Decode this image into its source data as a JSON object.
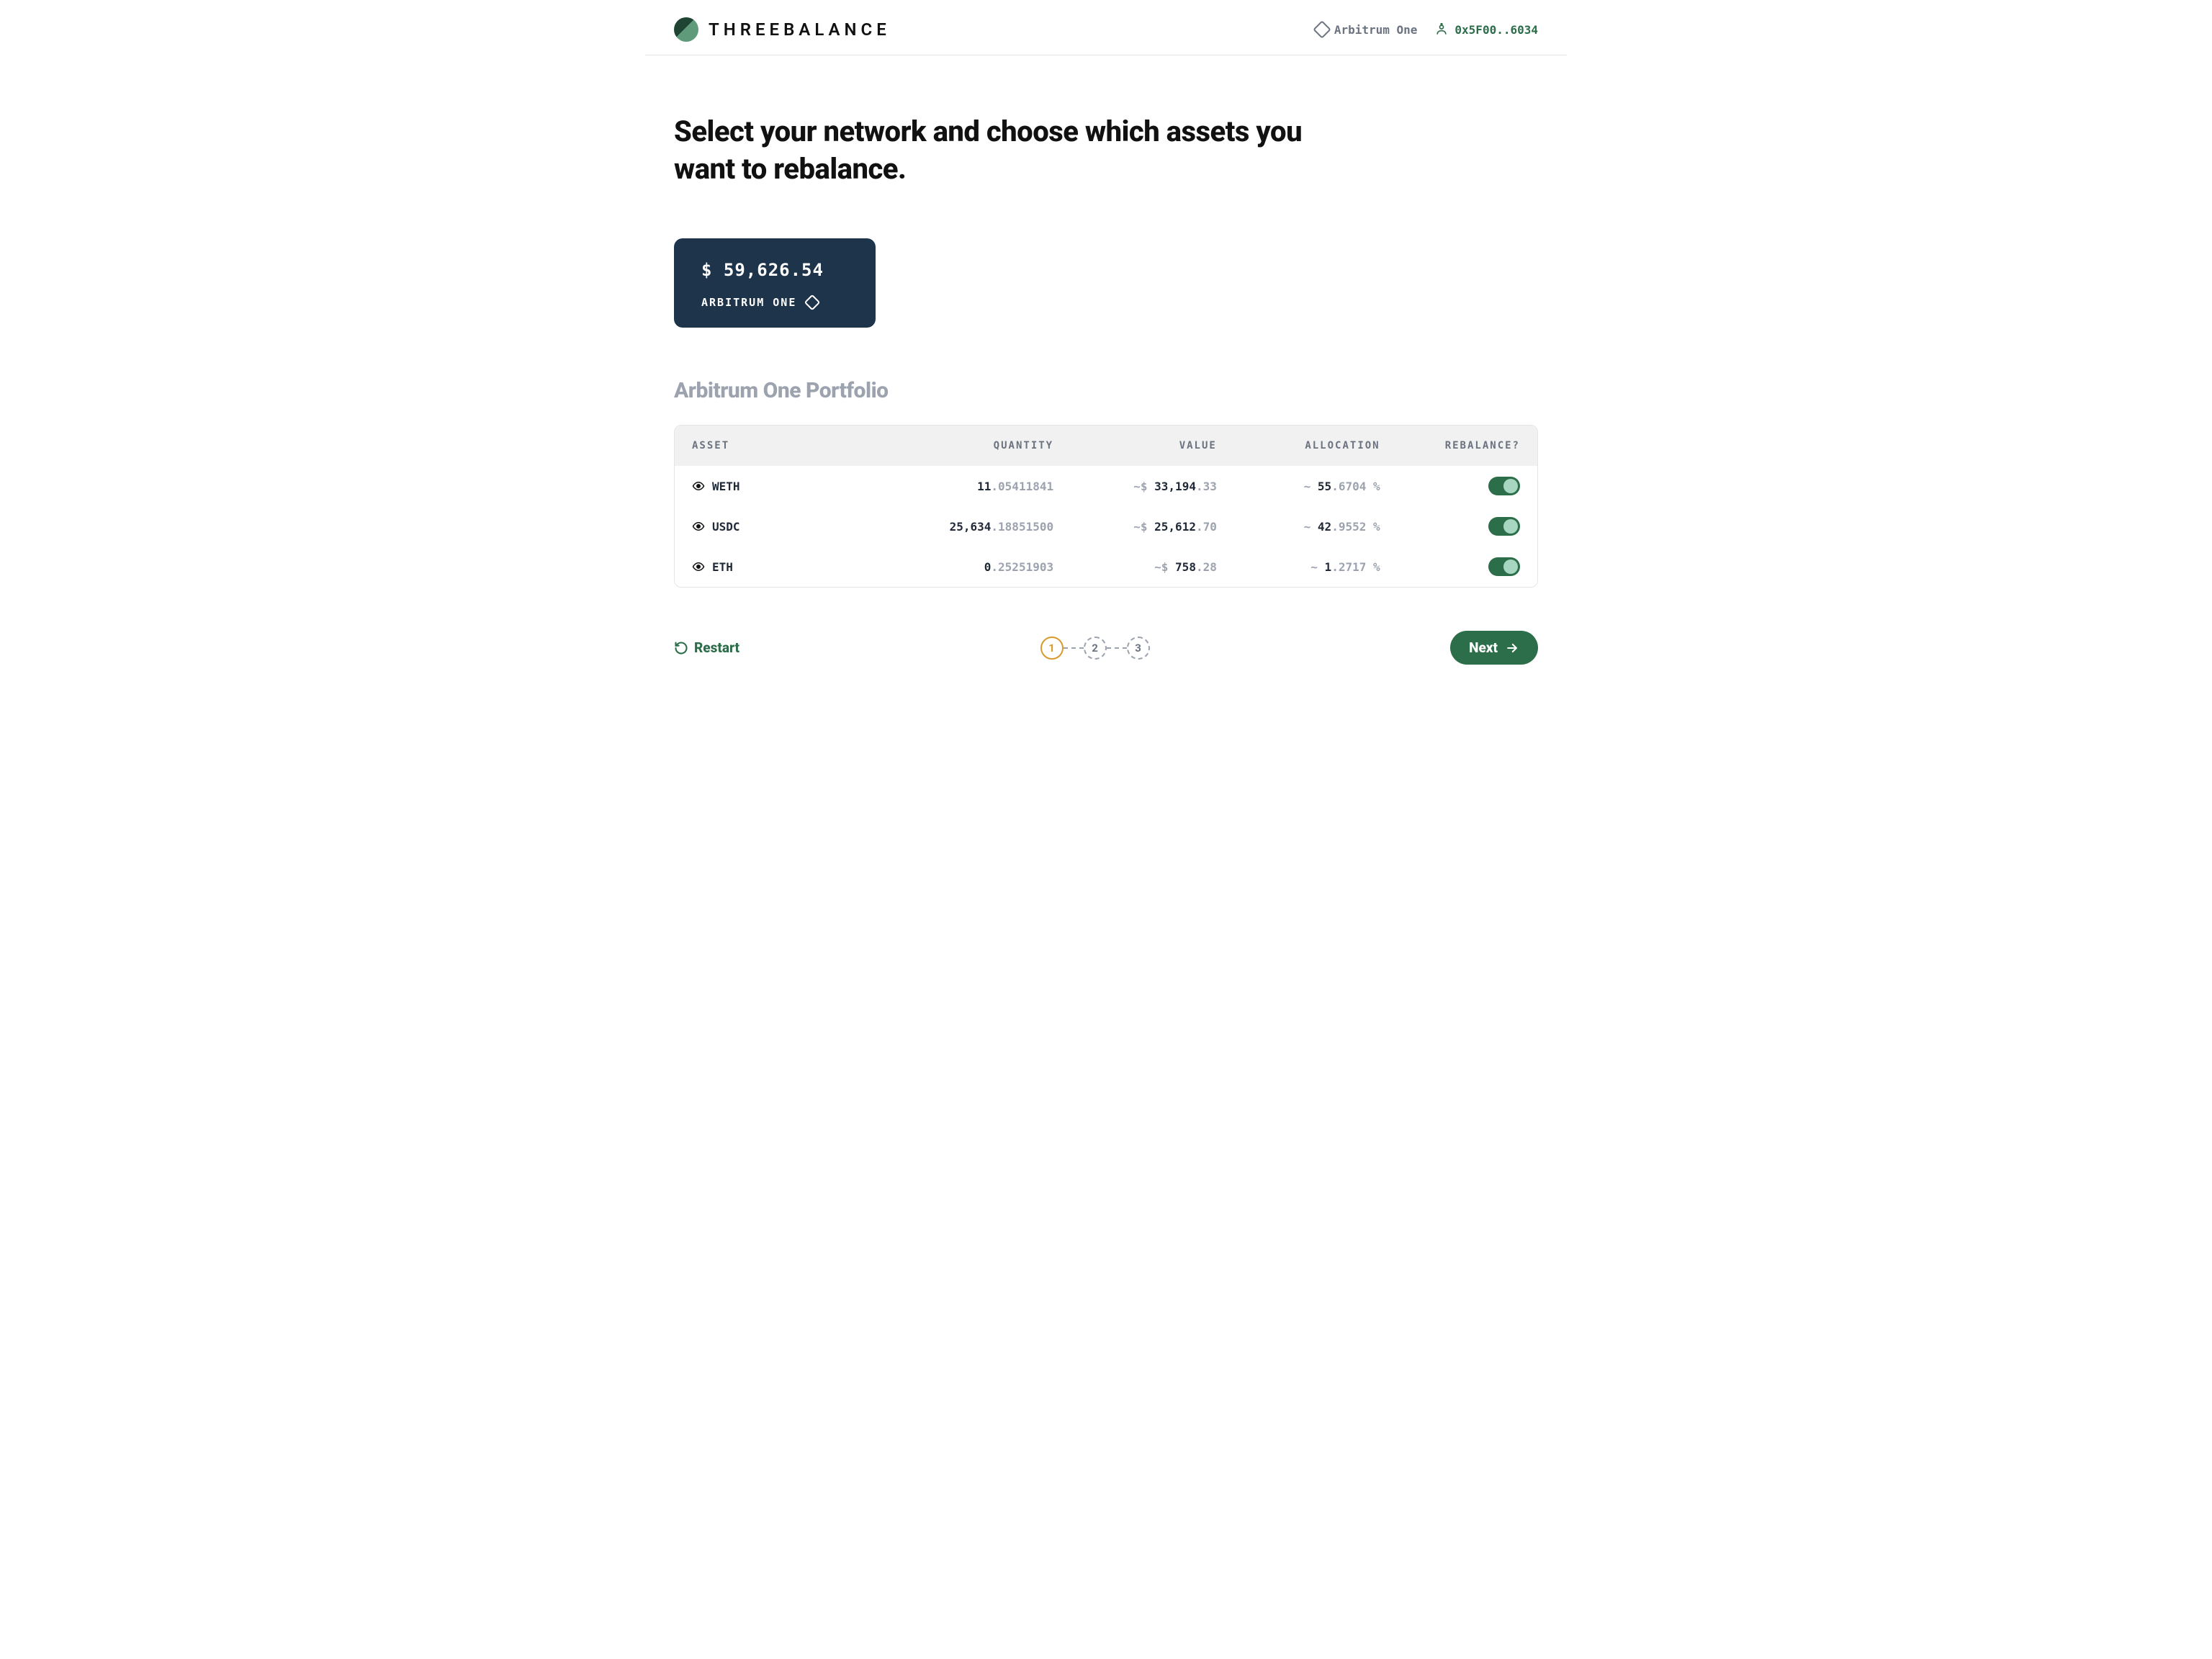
{
  "header": {
    "brand": "THREEBALANCE",
    "network": "Arbitrum One",
    "address": "0x5F00..6034"
  },
  "main": {
    "heading": "Select your network and choose which assets you want to rebalance.",
    "network_card": {
      "value": "$ 59,626.54",
      "label": "ARBITRUM ONE"
    },
    "portfolio_title": "Arbitrum One Portfolio"
  },
  "table": {
    "headers": {
      "asset": "ASSET",
      "quantity": "QUANTITY",
      "value": "VALUE",
      "allocation": "ALLOCATION",
      "rebalance": "REBALANCE?"
    },
    "rows": [
      {
        "asset": "WETH",
        "qty_int": "11",
        "qty_dec": ".05411841",
        "val_prefix": "~$ ",
        "val_int": "33,194",
        "val_dec": ".33",
        "alloc_prefix": "~ ",
        "alloc_int": "55",
        "alloc_dec": ".6704 %",
        "toggle": true
      },
      {
        "asset": "USDC",
        "qty_int": "25,634",
        "qty_dec": ".18851500",
        "val_prefix": "~$ ",
        "val_int": "25,612",
        "val_dec": ".70",
        "alloc_prefix": "~ ",
        "alloc_int": "42",
        "alloc_dec": ".9552 %",
        "toggle": true
      },
      {
        "asset": "ETH",
        "qty_int": "0",
        "qty_dec": ".25251903",
        "val_prefix": "~$ ",
        "val_int": "758",
        "val_dec": ".28",
        "alloc_prefix": "~ ",
        "alloc_int": "1",
        "alloc_dec": ".2717 %",
        "toggle": true
      }
    ]
  },
  "footer": {
    "restart": "Restart",
    "steps": [
      "1",
      "2",
      "3"
    ],
    "next": "Next"
  }
}
